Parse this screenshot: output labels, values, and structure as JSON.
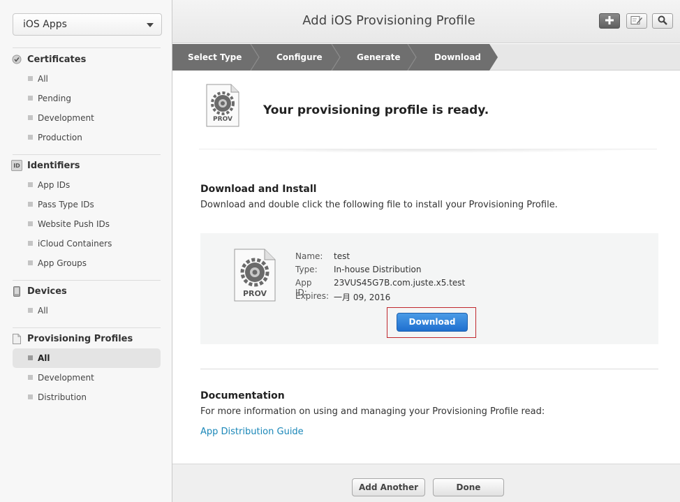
{
  "sidebar": {
    "app_selector": "iOS Apps",
    "sections": [
      {
        "title": "Certificates",
        "icon": "certificate-icon",
        "items": [
          "All",
          "Pending",
          "Development",
          "Production"
        ]
      },
      {
        "title": "Identifiers",
        "icon": "id-badge-icon",
        "icon_text": "ID",
        "items": [
          "App IDs",
          "Pass Type IDs",
          "Website Push IDs",
          "iCloud Containers",
          "App Groups"
        ]
      },
      {
        "title": "Devices",
        "icon": "device-icon",
        "items": [
          "All"
        ]
      },
      {
        "title": "Provisioning Profiles",
        "icon": "document-icon",
        "items": [
          "All",
          "Development",
          "Distribution"
        ],
        "active_item": "All"
      }
    ]
  },
  "header": {
    "title": "Add iOS Provisioning Profile",
    "buttons": [
      "add-icon",
      "edit-icon",
      "search-icon"
    ]
  },
  "steps": [
    "Select Type",
    "Configure",
    "Generate",
    "Download"
  ],
  "main": {
    "ready_message": "Your provisioning profile is ready.",
    "icon_label": "PROV",
    "download_section": {
      "heading": "Download and Install",
      "description": "Download and double click the following file to install your Provisioning Profile.",
      "profile": {
        "name_label": "Name:",
        "name": "test",
        "type_label": "Type:",
        "type": "In-house Distribution",
        "app_id_label": "App ID:",
        "app_id": "23VUS45G7B.com.juste.x5.test",
        "expires_label": "Expires:",
        "expires": "一月 09, 2016"
      },
      "download_button": "Download"
    },
    "documentation": {
      "heading": "Documentation",
      "description": "For more information on using and managing your Provisioning Profile read:",
      "link": "App Distribution Guide"
    }
  },
  "footer": {
    "add_another": "Add Another",
    "done": "Done"
  },
  "colors": {
    "step_bar": "#6f6f6f",
    "download_button": "#2b7fd8",
    "link": "#1a87b8",
    "highlight_frame": "#c0272d"
  }
}
